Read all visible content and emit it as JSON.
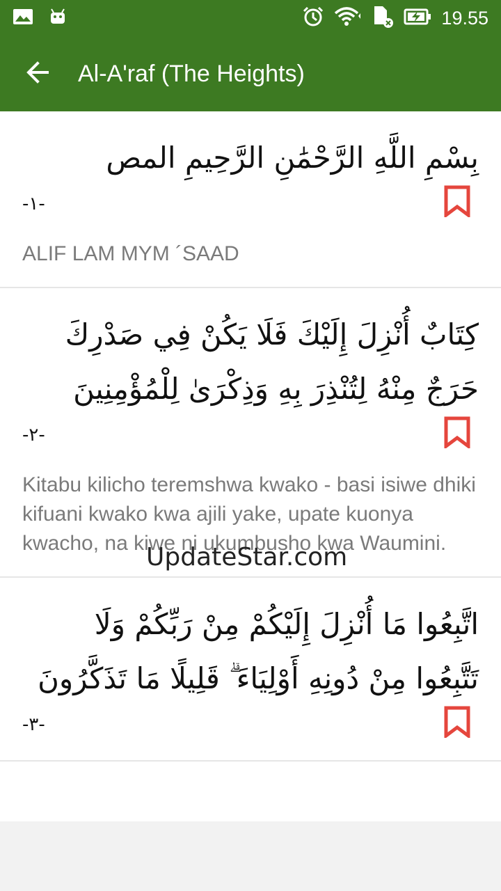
{
  "status": {
    "time": "19.55",
    "icons": [
      "image-icon",
      "android-icon",
      "alarm-icon",
      "wifi-icon",
      "sim-icon",
      "battery-charging-icon"
    ]
  },
  "appbar": {
    "title": "Al-A'raf (The Heights)",
    "back_icon": "arrow-left-icon"
  },
  "colors": {
    "primary": "#3d7a22",
    "bookmark": "#e5463d",
    "translation": "#7a7a7a"
  },
  "watermark": "UpdateStar.com",
  "verses": [
    {
      "arabic": "بِسْمِ اللَّهِ الرَّحْمَٰنِ الرَّحِيمِ المص",
      "number": "-١-",
      "translation": "ALIF LAM MYM ´SAAD"
    },
    {
      "arabic": "كِتَابٌ أُنْزِلَ إِلَيْكَ فَلَا يَكُنْ فِي صَدْرِكَ حَرَجٌ مِنْهُ لِتُنْذِرَ بِهِ وَذِكْرَىٰ لِلْمُؤْمِنِينَ",
      "number": "-٢-",
      "translation": "Kitabu kilicho teremshwa kwako - basi isiwe dhiki kifuani kwako kwa ajili yake, upate kuonya kwacho, na kiwe ni ukumbusho kwa Waumini."
    },
    {
      "arabic": "اتَّبِعُوا مَا أُنْزِلَ إِلَيْكُمْ مِنْ رَبِّكُمْ وَلَا تَتَّبِعُوا مِنْ دُونِهِ أَوْلِيَاءَ ۗ قَلِيلًا مَا تَذَكَّرُونَ",
      "number": "-٣-"
    }
  ]
}
